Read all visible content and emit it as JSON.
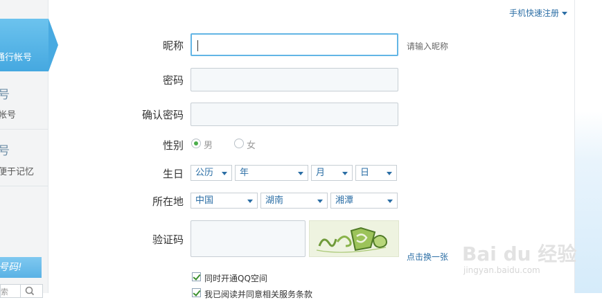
{
  "top_link": {
    "label": "手机快速注册"
  },
  "sidebar": {
    "active_item": {
      "label": "通行帐号"
    },
    "item2": {
      "big": "号",
      "small": "帐号"
    },
    "item3": {
      "big": "号",
      "small": "便于记忆"
    },
    "banner": {
      "text": "号码!"
    },
    "search": {
      "placeholder": "索"
    }
  },
  "form": {
    "nickname": {
      "label": "昵称",
      "hint": "请输入昵称",
      "value": ""
    },
    "password": {
      "label": "密码",
      "value": ""
    },
    "confirm_password": {
      "label": "确认密码",
      "value": ""
    },
    "gender": {
      "label": "性别",
      "options": [
        {
          "label": "男",
          "selected": true
        },
        {
          "label": "女",
          "selected": false
        }
      ]
    },
    "birthday": {
      "label": "生日",
      "calendar": "公历",
      "year": "年",
      "month": "月",
      "day": "日"
    },
    "location": {
      "label": "所在地",
      "country": "中国",
      "province": "湖南",
      "city": "湘潭"
    },
    "captcha": {
      "label": "验证码",
      "refresh_label": "点击换一张"
    },
    "options": [
      {
        "label": "同时开通QQ空间",
        "checked": true
      },
      {
        "label": "我已阅读并同意相关服务条款",
        "checked": true
      }
    ]
  },
  "watermark": {
    "main": "Bai du 经验",
    "sub": "jingyan.baidu.com"
  },
  "colors": {
    "accent": "#45a8e0",
    "link": "#2b6ea5",
    "focus_border": "#62b5e5",
    "check": "#4cae4c"
  }
}
